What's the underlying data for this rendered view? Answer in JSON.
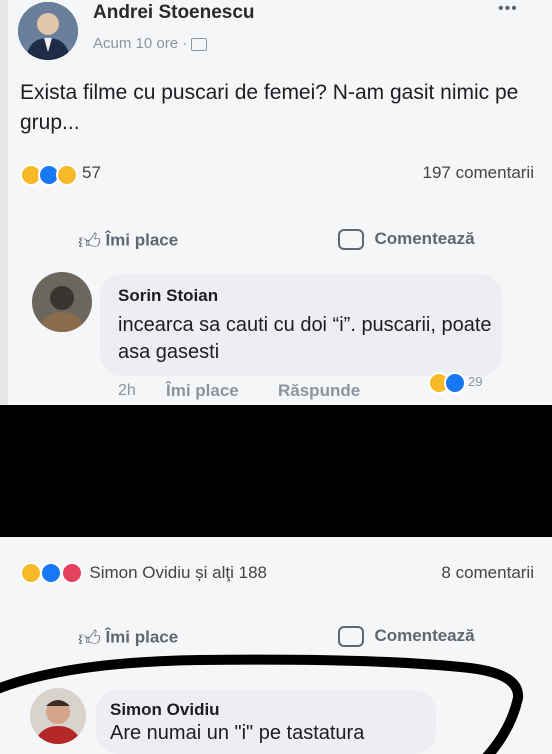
{
  "post": {
    "author": "Andrei Stoenescu",
    "time": "Acum 10 ore",
    "text": "Exista filme cu puscari de femei? N-am gasit nimic pe grup...",
    "reaction_count": "57",
    "comment_count": "197 comentarii",
    "like_label": "Îmi place",
    "comment_label": "Comentează",
    "more_label": "•••"
  },
  "comment1": {
    "author": "Sorin Stoian",
    "text": "incearca sa cauti cu doi “i”. puscarii, poate asa gasesti",
    "time": "2h",
    "like": "Îmi place",
    "reply": "Răspunde",
    "reaction_count": "29"
  },
  "post2": {
    "reactors": "Simon Ovidiu și alţi 188",
    "comment_count": "8 comentarii",
    "like_label": "Îmi place",
    "comment_label": "Comentează"
  },
  "comment2": {
    "author": "Simon Ovidiu",
    "text": "Are numai un \"i\" pe tastatura"
  },
  "colors": {
    "background": "#f5f6f7",
    "black_bar": "#000000",
    "like_blue": "#1877f2",
    "haha_yellow": "#f7b928",
    "love_red": "#e4405f"
  }
}
